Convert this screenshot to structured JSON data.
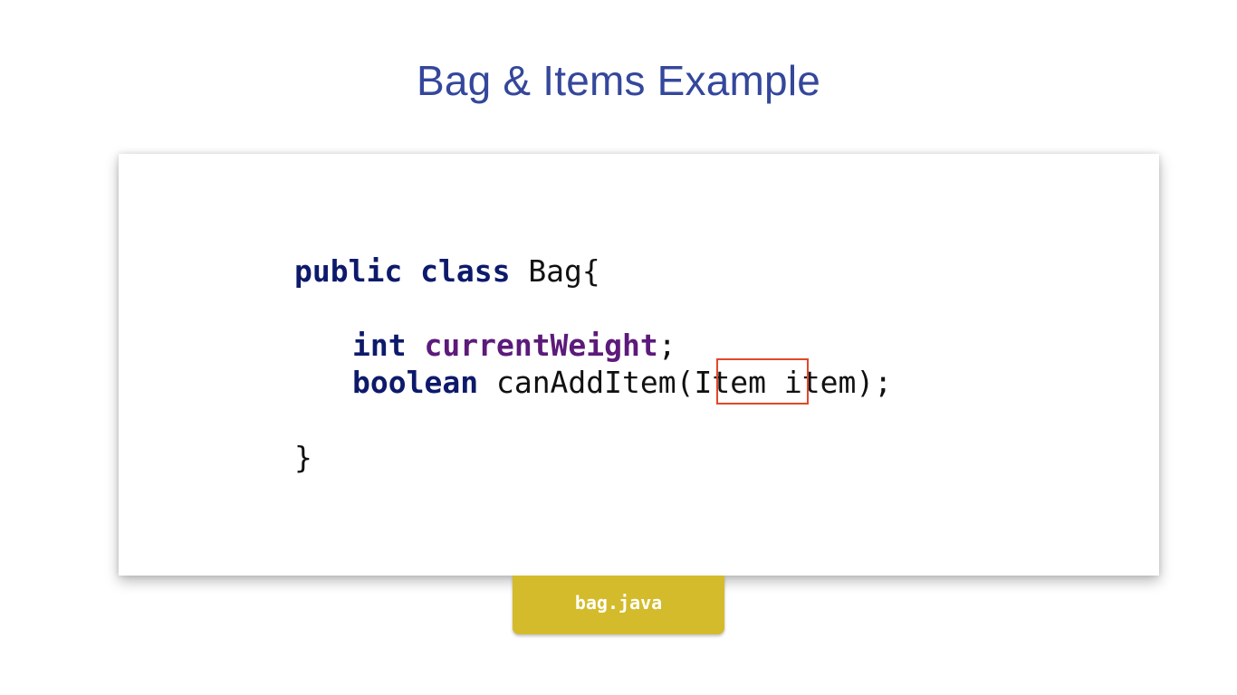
{
  "slide": {
    "title": "Bag & Items Example"
  },
  "code": {
    "line1": {
      "kw_public": "public",
      "kw_class": "class",
      "class_name": "Bag{"
    },
    "line2": {
      "kw_type": "int",
      "field_name": "currentWeight",
      "semicolon": ";"
    },
    "line3": {
      "kw_type": "boolean",
      "method_open": "canAddItem(",
      "param_type": "Item",
      "param_rest": " item);"
    },
    "line4": {
      "closing_brace": "}"
    }
  },
  "file_tab": {
    "label": "bag.java"
  },
  "colors": {
    "title": "#34479b",
    "keyword": "#0d1a6b",
    "field": "#5c1a7a",
    "highlight_border": "#e2472a",
    "tab_background": "#d4bb2b"
  }
}
